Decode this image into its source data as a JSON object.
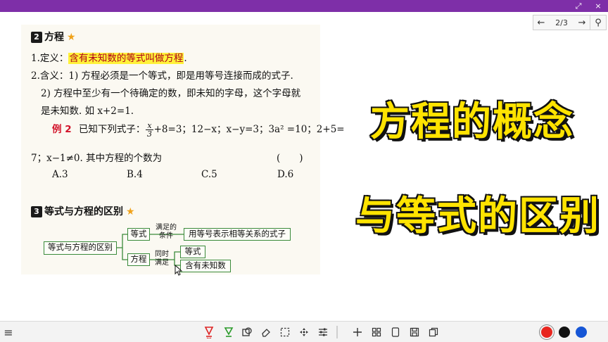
{
  "window": {
    "expand_icon": "⤢",
    "close_icon": "×"
  },
  "pager": {
    "prev_icon": "←",
    "page_text": "2/3",
    "next_icon": "→",
    "zoom_icon": "⚲"
  },
  "doc": {
    "sec2": {
      "num": "2",
      "title": "方程",
      "star": "★"
    },
    "def": {
      "prefix": "1.定义：",
      "highlight": "含有未知数的等式叫做方程",
      "suffix": "."
    },
    "meaning1": "2.含义：1) 方程必须是一个等式，即是用等号连接而成的式子.",
    "meaning2": "2) 方程中至少有一个待确定的数，即未知的字母，这个字母就",
    "meaning3": "是未知数. 如 x+2=1.",
    "ex2": {
      "label": "例 2",
      "lead": "已知下列式子：",
      "frac_num": "x",
      "frac_den": "3",
      "rest": "+8=3；12−x；x−y=3；3a² =10；2+5=",
      "line2": "7；x−1≠0. 其中方程的个数为",
      "paren": "(　　)",
      "options": [
        "A.3",
        "B.4",
        "C.5",
        "D.6"
      ]
    },
    "sec3": {
      "num": "3",
      "title": "等式与方程的区别",
      "star": "★"
    },
    "diagram": {
      "root": "等式与方程的区别",
      "eq_node": "等式",
      "eq_cond_line1": "满足的",
      "eq_cond_line2": "条件",
      "eq_desc": "用等号表示相等关系的式子",
      "fc_node": "方程",
      "fc_cond_line1": "同时",
      "fc_cond_line2": "满足",
      "fc_leaf1": "等式",
      "fc_leaf2": "含有未知数"
    }
  },
  "overlay": {
    "title_line1": "方程的概念",
    "title_line2": "与等式的区别"
  },
  "toolbar": {
    "menu_icon": "≡",
    "tools": [
      "pen-red",
      "pen-green",
      "shape",
      "eraser",
      "select",
      "move",
      "adjust",
      "add",
      "grid",
      "page",
      "save",
      "copy"
    ],
    "colors": [
      "#e8261f",
      "#111111",
      "#1656d6"
    ]
  }
}
